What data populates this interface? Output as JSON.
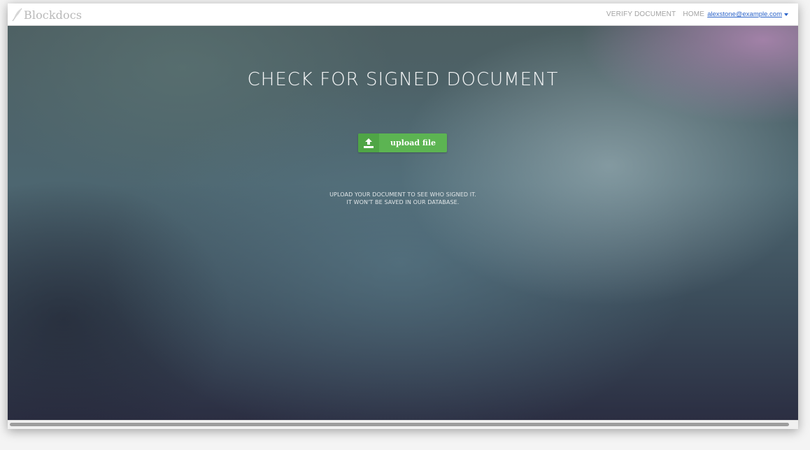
{
  "navbar": {
    "brand": "Blockdocs",
    "links": {
      "verify": "VERIFY DOCUMENT",
      "home": "HOME"
    },
    "user_email": "alexstone@example.com"
  },
  "hero": {
    "title": "CHECK FOR SIGNED DOCUMENT",
    "upload_button_label": "upload file",
    "info_line_1": "UPLOAD YOUR DOCUMENT TO SEE WHO SIGNED IT.",
    "info_line_2": "IT WON'T BE SAVED IN OUR DATABASE."
  },
  "colors": {
    "accent_green": "#5cb452",
    "link_blue": "#2a63c9"
  },
  "icons": [
    "feather-icon",
    "upload-icon",
    "caret-down-icon"
  ]
}
